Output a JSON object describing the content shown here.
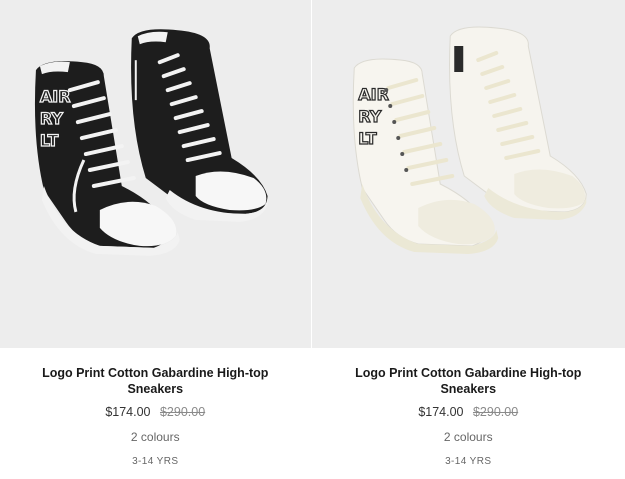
{
  "products": [
    {
      "name": "Logo Print Cotton Gabardine High-top Sneakers",
      "price": "$174.00",
      "original_price": "$290.00",
      "colours": "2 colours",
      "size_range": "3-14 YRS",
      "shoe_color": "#1d1d1d"
    },
    {
      "name": "Logo Print Cotton Gabardine High-top Sneakers",
      "price": "$174.00",
      "original_price": "$290.00",
      "colours": "2 colours",
      "size_range": "3-14 YRS",
      "shoe_color": "#f4f2ec"
    }
  ]
}
